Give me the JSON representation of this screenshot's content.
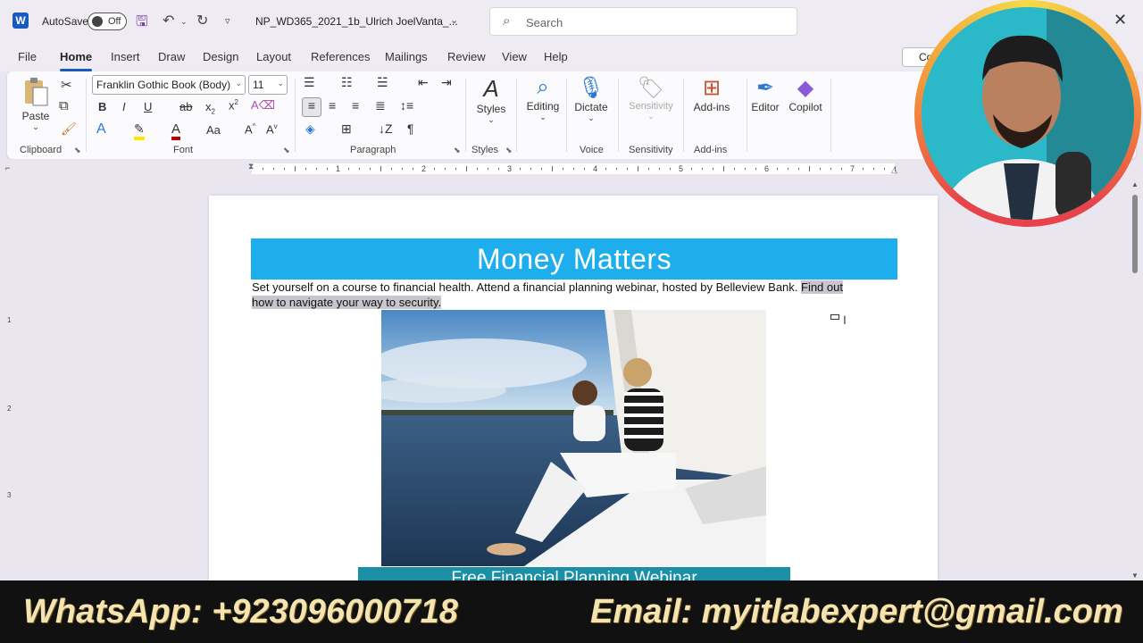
{
  "titlebar": {
    "app_logo": "W",
    "autosave_label": "AutoSave",
    "autosave_state": "Off",
    "document_title": "NP_WD365_2021_1b_Ulrich JoelVanta_...",
    "search_placeholder": "Search"
  },
  "tabs": [
    "File",
    "Home",
    "Insert",
    "Draw",
    "Design",
    "Layout",
    "References",
    "Mailings",
    "Review",
    "View",
    "Help"
  ],
  "active_tab": "Home",
  "comments_button": "Co",
  "ribbon": {
    "clipboard": {
      "paste_label": "Paste",
      "group_label": "Clipboard"
    },
    "font": {
      "font_name": "Franklin Gothic Book (Body)",
      "font_size": "11",
      "group_label": "Font"
    },
    "paragraph": {
      "group_label": "Paragraph"
    },
    "styles": {
      "label": "Styles",
      "group_label": "Styles"
    },
    "editing": {
      "label": "Editing"
    },
    "voice": {
      "label": "Dictate",
      "group_label": "Voice"
    },
    "sensitivity": {
      "label": "Sensitivity",
      "group_label": "Sensitivity"
    },
    "addins": {
      "label": "Add-ins",
      "group_label": "Add-ins"
    },
    "editor": {
      "label": "Editor"
    },
    "copilot": {
      "label": "Copilot"
    }
  },
  "ruler_numbers": [
    "1",
    "1",
    "2",
    "3",
    "4",
    "5",
    "6",
    "7"
  ],
  "vruler_numbers": [
    "1",
    "2",
    "3"
  ],
  "document": {
    "banner_title": "Money Matters",
    "body_text_plain": "Set yourself on a course to financial health. Attend a financial planning webinar, hosted by Belleview Bank. ",
    "body_text_selected_1": "Find out",
    "body_text_selected_2": "how to navigate your way to security. ",
    "webinar_title": "Free Financial Planning Webinar"
  },
  "footer": {
    "whatsapp": "WhatsApp: +923096000718",
    "email": "Email: myitlabexpert@gmail.com"
  },
  "colors": {
    "banner_blue": "#1eaeed",
    "webinar_teal": "#1a8fa6",
    "word_blue": "#185abd",
    "footer_text": "#f5e3b0"
  }
}
